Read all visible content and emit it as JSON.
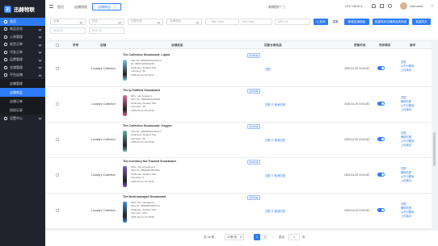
{
  "app": {
    "logo_text": "迅赫物联",
    "logo_letter": "迅"
  },
  "sidebar": {
    "items": [
      {
        "label": "首页",
        "icon": "home-icon",
        "active": true
      },
      {
        "label": "商品总览",
        "icon": "grid-icon"
      },
      {
        "label": "入库管理",
        "icon": "inbox-icon"
      },
      {
        "label": "发货订单",
        "icon": "truck-icon"
      },
      {
        "label": "代发订单",
        "icon": "order-icon"
      },
      {
        "label": "运费管理",
        "icon": "fee-icon"
      },
      {
        "label": "仓储管理",
        "icon": "warehouse-icon"
      },
      {
        "label": "平台店铺",
        "icon": "shop-icon"
      }
    ],
    "subitems": [
      {
        "label": "店铺管理",
        "active": false
      },
      {
        "label": "店铺商品",
        "active": true
      },
      {
        "label": "店铺订单",
        "active": false
      },
      {
        "label": "授权记录",
        "active": false
      }
    ],
    "last_item": {
      "label": "设置中心",
      "icon": "settings-icon"
    }
  },
  "topbar": {
    "tabs": [
      {
        "label": "首页"
      },
      {
        "label": "店铺授权"
      },
      {
        "label": "店铺商品",
        "active": true
      }
    ],
    "center_text": "新增用户 ⓘ",
    "timezone": "UTC+08:00",
    "username": "Username"
  },
  "filters": {
    "row1": [
      {
        "placeholder": "店铺",
        "dropdown": true
      },
      {
        "placeholder": "状态",
        "dropdown": true
      },
      {
        "placeholder": "匹配状态",
        "dropdown": true
      },
      {
        "placeholder": "店铺商品",
        "dropdown": true
      },
      {
        "placeholder": "Start Date"
      },
      {
        "placeholder": "End Date"
      },
      {
        "placeholder": "MPN ID"
      }
    ],
    "row2": [
      {
        "placeholder": "SKU ID"
      },
      {
        "placeholder": "SKU ID"
      }
    ],
    "search_label": "Q 查询",
    "reset_label": "重置",
    "btn_new_label": "新增店铺商品",
    "btn_sync_label": "批量同步店铺商品到系统",
    "btn_batch_label": "批量同步"
  },
  "table": {
    "headers": [
      "",
      "序号",
      "店铺",
      "店铺商品",
      "匹配仓库商品",
      "更新时间",
      "同步库存",
      "操作"
    ],
    "rows": [
      {
        "store": "Loowig's Collection",
        "name": "The Collection Snowboard: Liquid",
        "status": "ACTIVE",
        "sku": "SKU ID: 459552654154113",
        "sku_id": "ID: 49557456783233",
        "attr": "Attributes: Default Title",
        "inv": "Inventory: 50",
        "date": "2025-01-21 15:29:57",
        "match": "匹配",
        "time": "2025-04-29 19:34:55",
        "actions": [
          "匹配",
          "从不分配库",
          "上传库存"
        ],
        "color": "#7cc8e0"
      },
      {
        "store": "Loowig's Collection",
        "name": "The Ip Fulfilled Snowboard",
        "status": "ACTIVE",
        "sku": "SKU: sku-hosted-1",
        "sku_id": "SKU ID: 45952604415009",
        "attr": "Attributes: Default Title",
        "inv": "Inventory: 19",
        "date": "2025-01-21 15:29:56",
        "match": "匹配 ⊘ 取消匹配",
        "time": "2025-04-29 19:34:55",
        "actions": [
          "匹配",
          "解绑匹配",
          "从不分配库",
          "上传库存"
        ],
        "color": "#e06a9a"
      },
      {
        "store": "Loowig's Collection",
        "name": "The Collection Snowboard: Oxygen",
        "status": "ACTIVE",
        "sku": "SKU ID: 459552604461177",
        "sku_id": "",
        "attr": "Attributes: Default Title",
        "inv": "Inventory: 50",
        "date": "2025-01-21 15:29:56",
        "match": "匹配 ⊘ 取消匹配",
        "time": "2025-04-29 19:34:55",
        "actions": [
          "匹配",
          "解绑匹配",
          "从不分配库",
          "上传库存"
        ],
        "color": "#5fb0a0"
      },
      {
        "store": "Loowig's Collection",
        "name": "The Inventory Not Tracked Snowboard",
        "status": "ACTIVE",
        "sku": "SKU: sku-untracked-1",
        "sku_id": "SKU ID: 45952604383041",
        "attr": "Attributes: Default Title",
        "inv": "Inventory: 0",
        "date": "2025-01-21 15:29:55",
        "match": "匹配 ⊘ 取消匹配",
        "time": "2025-04-29 19:34:55",
        "actions": [
          "匹配",
          "解绑匹配",
          "从不分配库",
          "上传库存"
        ],
        "color": "#7a5ab8"
      },
      {
        "store": "Loowig's Collection",
        "name": "The Multi-managed Snowboard",
        "status": "ACTIVE",
        "sku": "SKU: sku-managed-1",
        "sku_id": "SKU ID: 45952604250721",
        "attr": "Attributes: Default Title",
        "inv": "Inventory: 100",
        "date": "2025-01-21 15:29:55",
        "match": "匹配 ⊘ 取消匹配",
        "time": "2025-04-29 19:34:55",
        "actions": [
          "匹配",
          "解绑匹配",
          "从不分配库",
          "上传库存"
        ],
        "color": "#3a8fd0"
      }
    ]
  },
  "pager": {
    "total": "共 33 条",
    "page_size": "20条/页",
    "pages": [
      "1",
      "2"
    ],
    "current": "1",
    "goto_label": "前往",
    "goto_value": "1",
    "page_suffix": "页"
  }
}
